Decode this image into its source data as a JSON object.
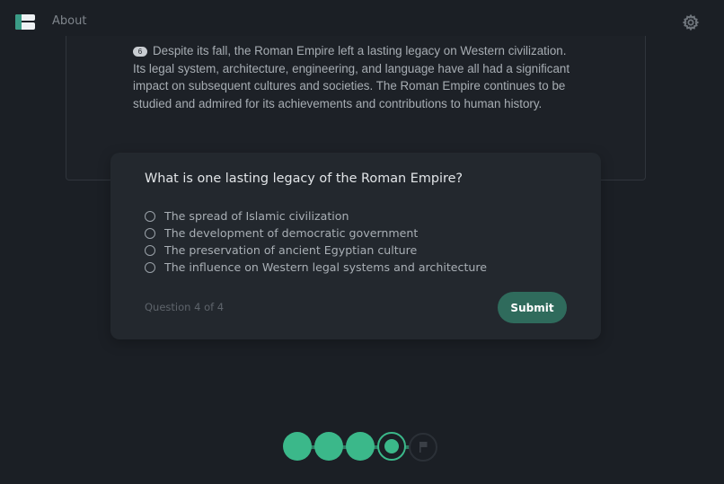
{
  "nav": {
    "about_label": "About"
  },
  "icons": {
    "logo": "app-logo-icon",
    "settings": "gear-icon",
    "finish": "flag-icon"
  },
  "colors": {
    "accent": "#3bb88a",
    "submit_bg": "#2f6b5c",
    "background": "#1b1f25"
  },
  "passage": {
    "paragraph_number": "6",
    "text": "Despite its fall, the Roman Empire left a lasting legacy on Western civilization. Its legal system, architecture, engineering, and language have all had a significant impact on subsequent cultures and societies. The Roman Empire continues to be studied and admired for its achievements and contributions to human history."
  },
  "quiz": {
    "question": "What is one lasting legacy of the Roman Empire?",
    "options": [
      "The spread of Islamic civilization",
      "The development of democratic government",
      "The preservation of ancient Egyptian culture",
      "The influence on Western legal systems and architecture"
    ],
    "progress_text": "Question 4 of 4",
    "submit_label": "Submit"
  },
  "stepper": {
    "total_questions": 4,
    "completed": 3,
    "current": 4
  }
}
